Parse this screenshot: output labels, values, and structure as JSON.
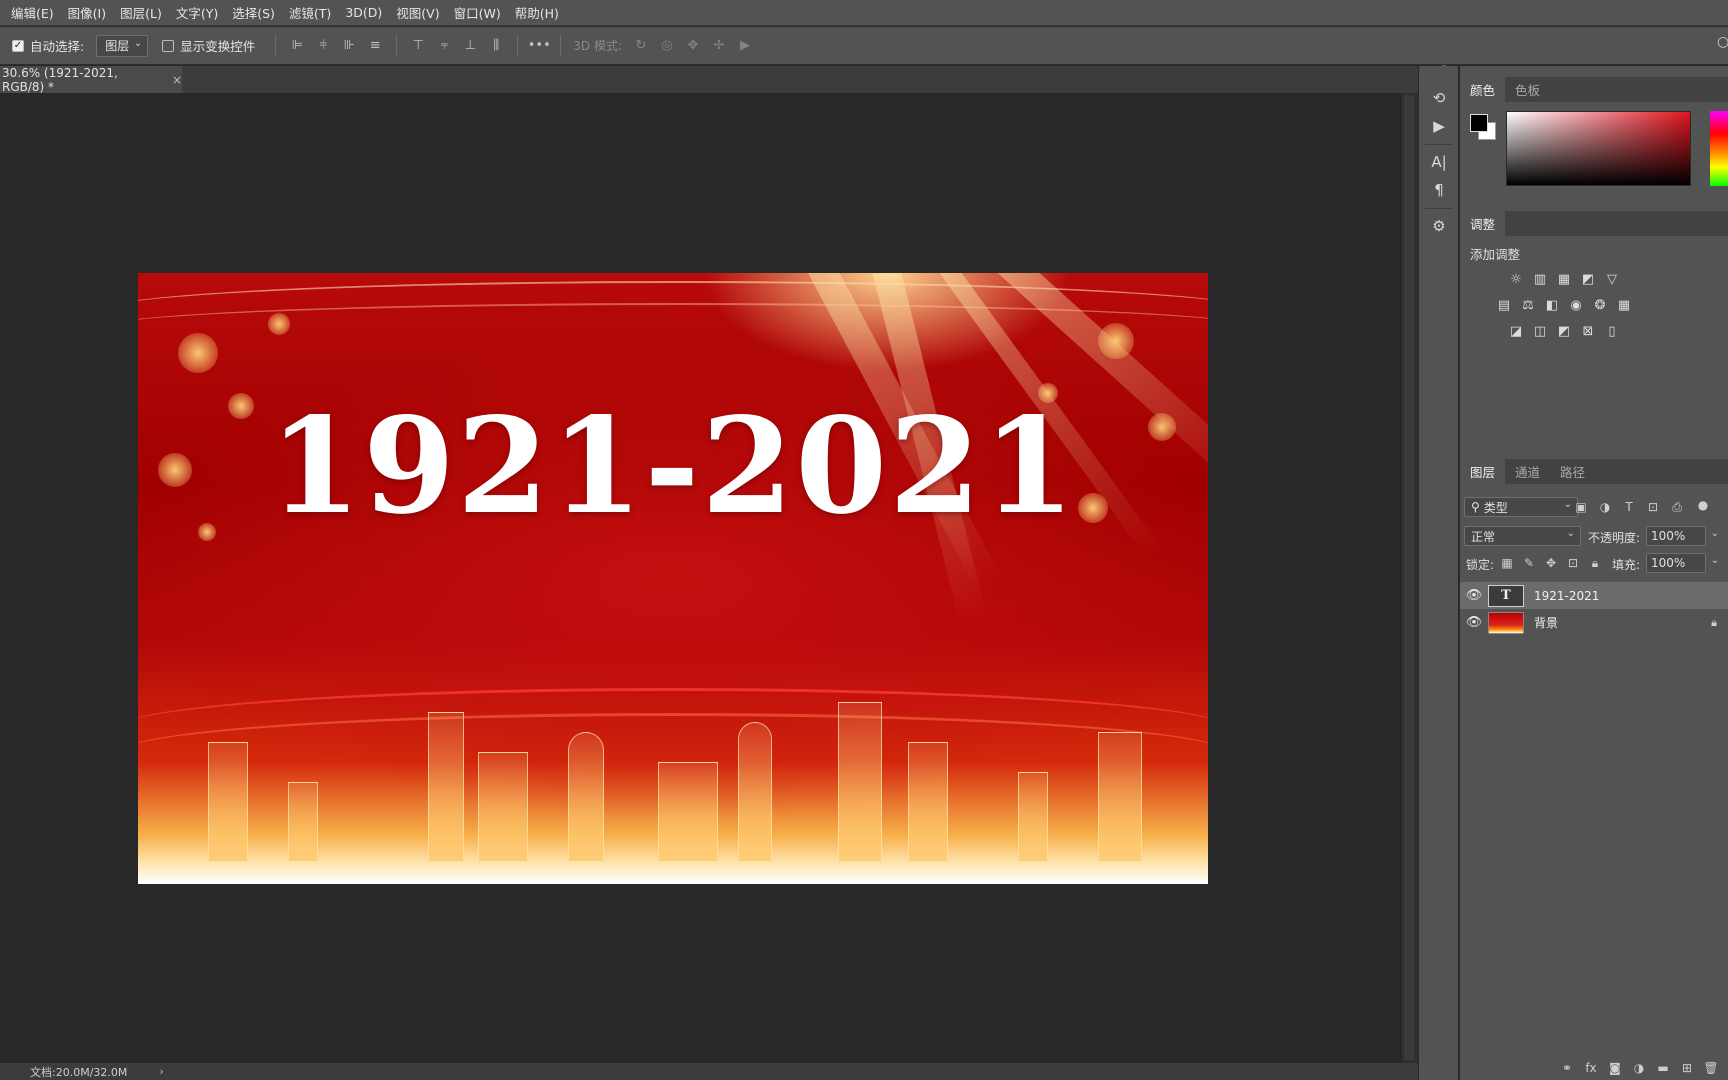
{
  "menu": [
    "编辑(E)",
    "图像(I)",
    "图层(L)",
    "文字(Y)",
    "选择(S)",
    "滤镜(T)",
    "3D(D)",
    "视图(V)",
    "窗口(W)",
    "帮助(H)"
  ],
  "options": {
    "auto_select_label": "自动选择:",
    "auto_select_value": "图层",
    "show_transform_label": "显示变换控件",
    "more_label": "•••",
    "mode_3d_label": "3D 模式:"
  },
  "document": {
    "tab_title": "30.6% (1921-2021, RGB/8) *",
    "close_glyph": "×",
    "artwork_text": "1921-2021"
  },
  "status": {
    "doc_info": "文档:20.0M/32.0M",
    "arrow": "›"
  },
  "color_panel": {
    "tabs": [
      "颜色",
      "色板"
    ],
    "fg_color": "#000000",
    "bg_color": "#ffffff"
  },
  "adjustments_panel": {
    "tab": "调整",
    "add_label": "添加调整"
  },
  "layers_panel": {
    "tabs": [
      "图层",
      "通道",
      "路径"
    ],
    "filter_type": "类型",
    "blend_mode": "正常",
    "opacity_label": "不透明度:",
    "opacity_value": "100%",
    "lock_label": "锁定:",
    "fill_label": "填充:",
    "fill_value": "100%",
    "layers": [
      {
        "name": "1921-2021",
        "kind": "text",
        "thumb": "T",
        "selected": true
      },
      {
        "name": "背景",
        "kind": "background",
        "locked": true
      }
    ]
  },
  "colors": {
    "chrome": "#535353",
    "canvas_bg": "#282828",
    "artwork_red": "#b80a0a"
  }
}
